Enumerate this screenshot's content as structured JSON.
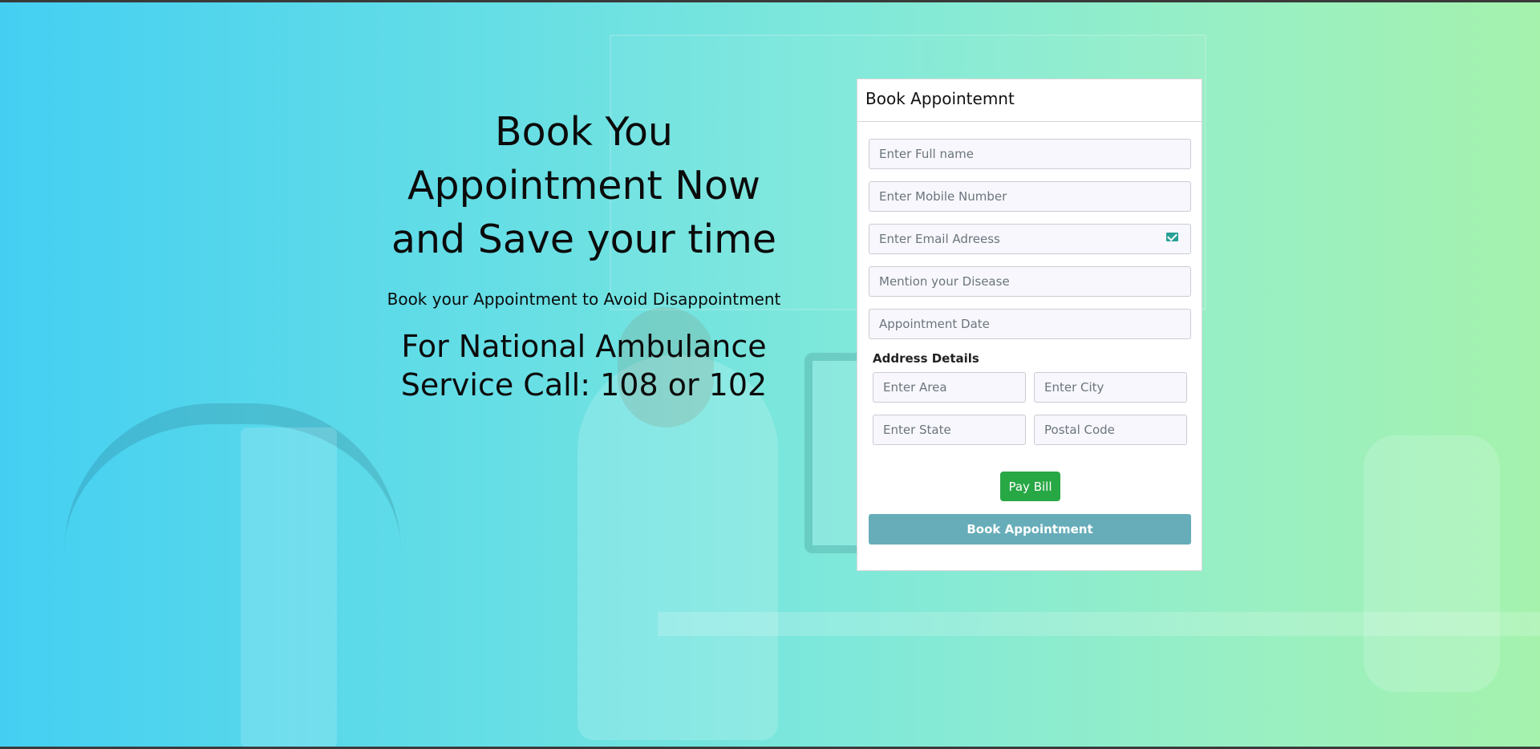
{
  "hero": {
    "title_line1": "Book You",
    "title_line2": "Appointment Now",
    "title_line3": "and Save your time",
    "subtitle": "Book your Appointment to Avoid Disappointment",
    "ambulance_line1": "For National Ambulance",
    "ambulance_line2": "Service Call: 108 or 102"
  },
  "form": {
    "title": "Book Appointemnt",
    "full_name_placeholder": "Enter Full name",
    "mobile_placeholder": "Enter Mobile Number",
    "email_placeholder": "Enter Email Adreess",
    "disease_placeholder": "Mention your Disease",
    "date_placeholder": "Appointment Date",
    "address_label": "Address Details",
    "area_placeholder": "Enter Area",
    "city_placeholder": "Enter City",
    "state_placeholder": "Enter State",
    "postal_placeholder": "Postal Code",
    "pay_bill_label": "Pay Bill",
    "book_label": "Book Appointment"
  },
  "icons": {
    "email_field_icon": "mail-icon"
  },
  "colors": {
    "gradient_start": "#44cff2",
    "gradient_end": "#a5f2ad",
    "pay_button": "#28a745",
    "book_button": "#66adb9"
  }
}
